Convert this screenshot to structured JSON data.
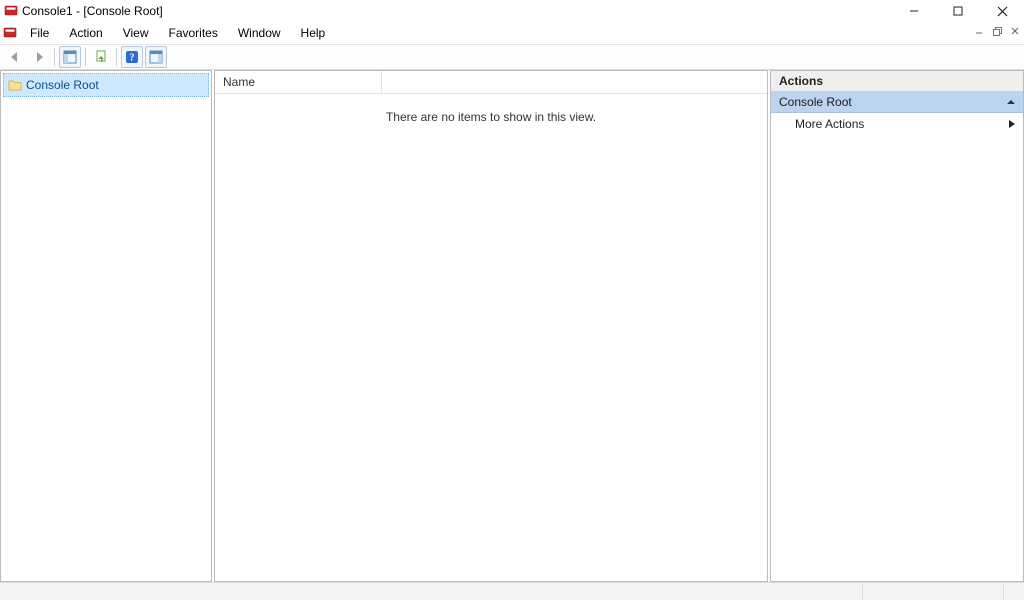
{
  "window": {
    "title": "Console1 - [Console Root]"
  },
  "menu": {
    "file": "File",
    "action": "Action",
    "view": "View",
    "favorites": "Favorites",
    "window": "Window",
    "help": "Help"
  },
  "tree": {
    "root_label": "Console Root"
  },
  "list": {
    "columns": {
      "name": "Name"
    },
    "empty_text": "There are no items to show in this view."
  },
  "actions": {
    "title": "Actions",
    "group_label": "Console Root",
    "more_actions": "More Actions"
  }
}
